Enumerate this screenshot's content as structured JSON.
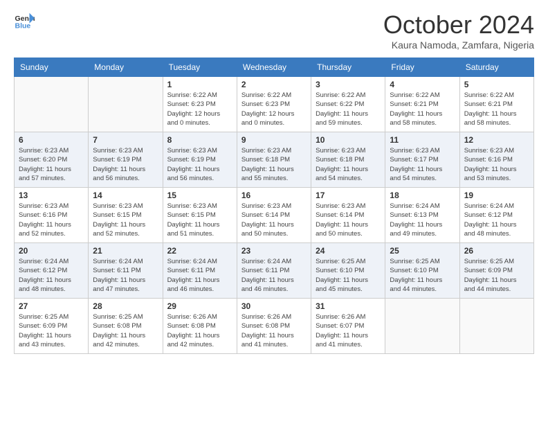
{
  "header": {
    "logo_line1": "General",
    "logo_line2": "Blue",
    "month": "October 2024",
    "location": "Kaura Namoda, Zamfara, Nigeria"
  },
  "weekdays": [
    "Sunday",
    "Monday",
    "Tuesday",
    "Wednesday",
    "Thursday",
    "Friday",
    "Saturday"
  ],
  "weeks": [
    [
      {
        "day": "",
        "info": ""
      },
      {
        "day": "",
        "info": ""
      },
      {
        "day": "1",
        "info": "Sunrise: 6:22 AM\nSunset: 6:23 PM\nDaylight: 12 hours\nand 0 minutes."
      },
      {
        "day": "2",
        "info": "Sunrise: 6:22 AM\nSunset: 6:23 PM\nDaylight: 12 hours\nand 0 minutes."
      },
      {
        "day": "3",
        "info": "Sunrise: 6:22 AM\nSunset: 6:22 PM\nDaylight: 11 hours\nand 59 minutes."
      },
      {
        "day": "4",
        "info": "Sunrise: 6:22 AM\nSunset: 6:21 PM\nDaylight: 11 hours\nand 58 minutes."
      },
      {
        "day": "5",
        "info": "Sunrise: 6:22 AM\nSunset: 6:21 PM\nDaylight: 11 hours\nand 58 minutes."
      }
    ],
    [
      {
        "day": "6",
        "info": "Sunrise: 6:23 AM\nSunset: 6:20 PM\nDaylight: 11 hours\nand 57 minutes."
      },
      {
        "day": "7",
        "info": "Sunrise: 6:23 AM\nSunset: 6:19 PM\nDaylight: 11 hours\nand 56 minutes."
      },
      {
        "day": "8",
        "info": "Sunrise: 6:23 AM\nSunset: 6:19 PM\nDaylight: 11 hours\nand 56 minutes."
      },
      {
        "day": "9",
        "info": "Sunrise: 6:23 AM\nSunset: 6:18 PM\nDaylight: 11 hours\nand 55 minutes."
      },
      {
        "day": "10",
        "info": "Sunrise: 6:23 AM\nSunset: 6:18 PM\nDaylight: 11 hours\nand 54 minutes."
      },
      {
        "day": "11",
        "info": "Sunrise: 6:23 AM\nSunset: 6:17 PM\nDaylight: 11 hours\nand 54 minutes."
      },
      {
        "day": "12",
        "info": "Sunrise: 6:23 AM\nSunset: 6:16 PM\nDaylight: 11 hours\nand 53 minutes."
      }
    ],
    [
      {
        "day": "13",
        "info": "Sunrise: 6:23 AM\nSunset: 6:16 PM\nDaylight: 11 hours\nand 52 minutes."
      },
      {
        "day": "14",
        "info": "Sunrise: 6:23 AM\nSunset: 6:15 PM\nDaylight: 11 hours\nand 52 minutes."
      },
      {
        "day": "15",
        "info": "Sunrise: 6:23 AM\nSunset: 6:15 PM\nDaylight: 11 hours\nand 51 minutes."
      },
      {
        "day": "16",
        "info": "Sunrise: 6:23 AM\nSunset: 6:14 PM\nDaylight: 11 hours\nand 50 minutes."
      },
      {
        "day": "17",
        "info": "Sunrise: 6:23 AM\nSunset: 6:14 PM\nDaylight: 11 hours\nand 50 minutes."
      },
      {
        "day": "18",
        "info": "Sunrise: 6:24 AM\nSunset: 6:13 PM\nDaylight: 11 hours\nand 49 minutes."
      },
      {
        "day": "19",
        "info": "Sunrise: 6:24 AM\nSunset: 6:12 PM\nDaylight: 11 hours\nand 48 minutes."
      }
    ],
    [
      {
        "day": "20",
        "info": "Sunrise: 6:24 AM\nSunset: 6:12 PM\nDaylight: 11 hours\nand 48 minutes."
      },
      {
        "day": "21",
        "info": "Sunrise: 6:24 AM\nSunset: 6:11 PM\nDaylight: 11 hours\nand 47 minutes."
      },
      {
        "day": "22",
        "info": "Sunrise: 6:24 AM\nSunset: 6:11 PM\nDaylight: 11 hours\nand 46 minutes."
      },
      {
        "day": "23",
        "info": "Sunrise: 6:24 AM\nSunset: 6:11 PM\nDaylight: 11 hours\nand 46 minutes."
      },
      {
        "day": "24",
        "info": "Sunrise: 6:25 AM\nSunset: 6:10 PM\nDaylight: 11 hours\nand 45 minutes."
      },
      {
        "day": "25",
        "info": "Sunrise: 6:25 AM\nSunset: 6:10 PM\nDaylight: 11 hours\nand 44 minutes."
      },
      {
        "day": "26",
        "info": "Sunrise: 6:25 AM\nSunset: 6:09 PM\nDaylight: 11 hours\nand 44 minutes."
      }
    ],
    [
      {
        "day": "27",
        "info": "Sunrise: 6:25 AM\nSunset: 6:09 PM\nDaylight: 11 hours\nand 43 minutes."
      },
      {
        "day": "28",
        "info": "Sunrise: 6:25 AM\nSunset: 6:08 PM\nDaylight: 11 hours\nand 42 minutes."
      },
      {
        "day": "29",
        "info": "Sunrise: 6:26 AM\nSunset: 6:08 PM\nDaylight: 11 hours\nand 42 minutes."
      },
      {
        "day": "30",
        "info": "Sunrise: 6:26 AM\nSunset: 6:08 PM\nDaylight: 11 hours\nand 41 minutes."
      },
      {
        "day": "31",
        "info": "Sunrise: 6:26 AM\nSunset: 6:07 PM\nDaylight: 11 hours\nand 41 minutes."
      },
      {
        "day": "",
        "info": ""
      },
      {
        "day": "",
        "info": ""
      }
    ]
  ]
}
